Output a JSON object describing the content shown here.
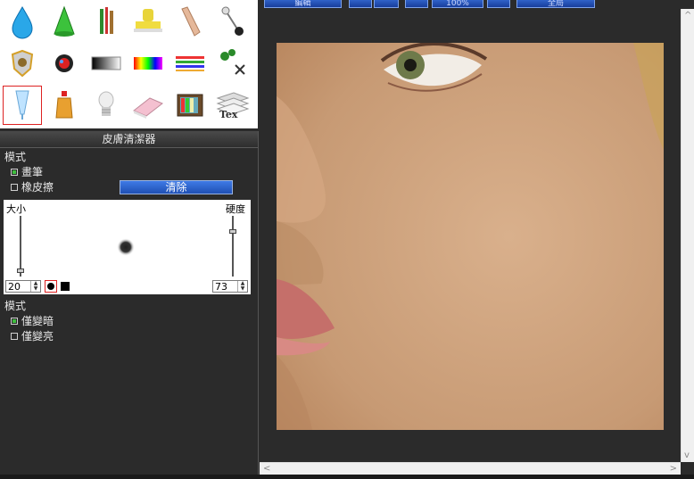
{
  "toolbar": {
    "btn1": "編輯",
    "zoom": "100%",
    "btn_right": "全局"
  },
  "palette": {
    "tools": [
      {
        "icon": "water-drop-icon"
      },
      {
        "icon": "cone-icon"
      },
      {
        "icon": "pencils-icon"
      },
      {
        "icon": "stamp-icon"
      },
      {
        "icon": "finger-smudge-icon"
      },
      {
        "icon": "pin-icon"
      },
      {
        "icon": "shield-icon"
      },
      {
        "icon": "red-eye-icon"
      },
      {
        "icon": "gradient-icon"
      },
      {
        "icon": "rainbow-icon"
      },
      {
        "icon": "lines-icon"
      },
      {
        "icon": "scissors-icon"
      },
      {
        "icon": "skin-cleaner-icon",
        "selected": true
      },
      {
        "icon": "bottle-icon"
      },
      {
        "icon": "bulb-icon"
      },
      {
        "icon": "eraser-icon"
      },
      {
        "icon": "tv-icon"
      },
      {
        "icon": "text-layers-icon"
      }
    ],
    "text_icon_label": "Tex"
  },
  "panel": {
    "title": "皮膚清潔器",
    "mode1_label": "模式",
    "opt_brush": "畫筆",
    "opt_eraser": "橡皮擦",
    "clear": "清除",
    "size_label": "大小",
    "hardness_label": "硬度",
    "size_value": "20",
    "hardness_value": "73",
    "mode2_label": "模式",
    "opt_darken": "僅變暗",
    "opt_lighten": "僅變亮"
  },
  "colors": {
    "accent": "#1f4fb4",
    "selected_border": "#dd2222",
    "checkbox_on": "#3fbf3f"
  }
}
